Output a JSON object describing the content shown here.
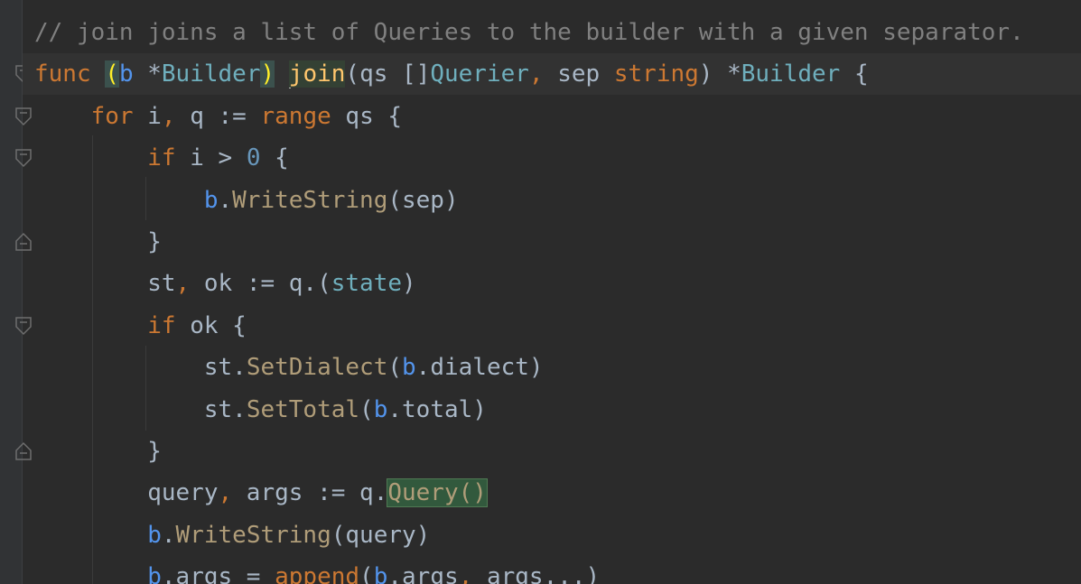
{
  "editor": {
    "language": "Go",
    "colors": {
      "background": "#2b2b2b",
      "gutter": "#313335",
      "keyword": "#cc7832",
      "comment": "#808080",
      "type": "#6fafbd",
      "receiver": "#5394ec",
      "function_declaration": "#ffc66d",
      "method_call": "#b09d79",
      "number": "#6897bb",
      "default_text": "#a9b7c6",
      "bracket_match": "#ffef28"
    },
    "lines": [
      {
        "tokens": [
          {
            "t": "// join joins a list of Queries to the builder with a given separator.",
            "c": "comment"
          }
        ]
      },
      {
        "tokens": [
          {
            "t": "func",
            "c": "kw"
          },
          {
            "t": " ",
            "c": "plain"
          },
          {
            "t": "(",
            "c": "paren-match"
          },
          {
            "t": "b",
            "c": "recv"
          },
          {
            "t": " *",
            "c": "plain"
          },
          {
            "t": "Builder",
            "c": "type"
          },
          {
            "t": ")",
            "c": "paren-match"
          },
          {
            "t": " ",
            "c": "plain"
          },
          {
            "t": "join",
            "c": "fn-decl",
            "caret": true
          },
          {
            "t": "(qs []",
            "c": "plain"
          },
          {
            "t": "Querier",
            "c": "type"
          },
          {
            "t": ", ",
            "c": "kw"
          },
          {
            "t": "sep ",
            "c": "plain"
          },
          {
            "t": "string",
            "c": "kw"
          },
          {
            "t": ") *",
            "c": "plain"
          },
          {
            "t": "Builder",
            "c": "type"
          },
          {
            "t": " {",
            "c": "plain"
          }
        ]
      },
      {
        "tokens": [
          {
            "t": "    ",
            "c": "plain"
          },
          {
            "t": "for",
            "c": "kw"
          },
          {
            "t": " i",
            "c": "plain"
          },
          {
            "t": ",",
            "c": "kw"
          },
          {
            "t": " q := ",
            "c": "plain"
          },
          {
            "t": "range",
            "c": "kw"
          },
          {
            "t": " qs {",
            "c": "plain"
          }
        ]
      },
      {
        "tokens": [
          {
            "t": "        ",
            "c": "plain"
          },
          {
            "t": "if",
            "c": "kw"
          },
          {
            "t": " i > ",
            "c": "plain"
          },
          {
            "t": "0",
            "c": "num"
          },
          {
            "t": " {",
            "c": "plain"
          }
        ]
      },
      {
        "tokens": [
          {
            "t": "            ",
            "c": "plain"
          },
          {
            "t": "b",
            "c": "recv"
          },
          {
            "t": ".",
            "c": "plain"
          },
          {
            "t": "WriteString",
            "c": "method"
          },
          {
            "t": "(sep)",
            "c": "plain"
          }
        ]
      },
      {
        "tokens": [
          {
            "t": "        }",
            "c": "plain"
          }
        ]
      },
      {
        "tokens": [
          {
            "t": "        st",
            "c": "plain"
          },
          {
            "t": ",",
            "c": "kw"
          },
          {
            "t": " ok := q.(",
            "c": "plain"
          },
          {
            "t": "state",
            "c": "type"
          },
          {
            "t": ")",
            "c": "plain"
          }
        ]
      },
      {
        "tokens": [
          {
            "t": "        ",
            "c": "plain"
          },
          {
            "t": "if",
            "c": "kw"
          },
          {
            "t": " ok {",
            "c": "plain"
          }
        ]
      },
      {
        "tokens": [
          {
            "t": "            st.",
            "c": "plain"
          },
          {
            "t": "SetDialect",
            "c": "method"
          },
          {
            "t": "(",
            "c": "plain"
          },
          {
            "t": "b",
            "c": "recv"
          },
          {
            "t": ".dialect)",
            "c": "plain"
          }
        ]
      },
      {
        "tokens": [
          {
            "t": "            st.",
            "c": "plain"
          },
          {
            "t": "SetTotal",
            "c": "method"
          },
          {
            "t": "(",
            "c": "plain"
          },
          {
            "t": "b",
            "c": "recv"
          },
          {
            "t": ".total)",
            "c": "plain"
          }
        ]
      },
      {
        "tokens": [
          {
            "t": "        }",
            "c": "plain"
          }
        ]
      },
      {
        "tokens": [
          {
            "t": "        query",
            "c": "plain"
          },
          {
            "t": ",",
            "c": "kw"
          },
          {
            "t": " args := q.",
            "c": "plain"
          },
          {
            "t": "Query()",
            "c": "method query-hl"
          }
        ]
      },
      {
        "tokens": [
          {
            "t": "        ",
            "c": "plain"
          },
          {
            "t": "b",
            "c": "recv"
          },
          {
            "t": ".",
            "c": "plain"
          },
          {
            "t": "WriteString",
            "c": "method"
          },
          {
            "t": "(query)",
            "c": "plain"
          }
        ]
      },
      {
        "tokens": [
          {
            "t": "        ",
            "c": "plain"
          },
          {
            "t": "b",
            "c": "recv"
          },
          {
            "t": ".args = ",
            "c": "plain"
          },
          {
            "t": "append",
            "c": "builtin"
          },
          {
            "t": "(",
            "c": "plain"
          },
          {
            "t": "b",
            "c": "recv"
          },
          {
            "t": ".args",
            "c": "plain"
          },
          {
            "t": ",",
            "c": "kw"
          },
          {
            "t": " args...)",
            "c": "plain"
          }
        ]
      }
    ],
    "fold_markers": [
      {
        "line": 1,
        "kind": "open"
      },
      {
        "line": 2,
        "kind": "open"
      },
      {
        "line": 3,
        "kind": "open"
      },
      {
        "line": 5,
        "kind": "close"
      },
      {
        "line": 7,
        "kind": "open"
      },
      {
        "line": 10,
        "kind": "close"
      }
    ]
  }
}
